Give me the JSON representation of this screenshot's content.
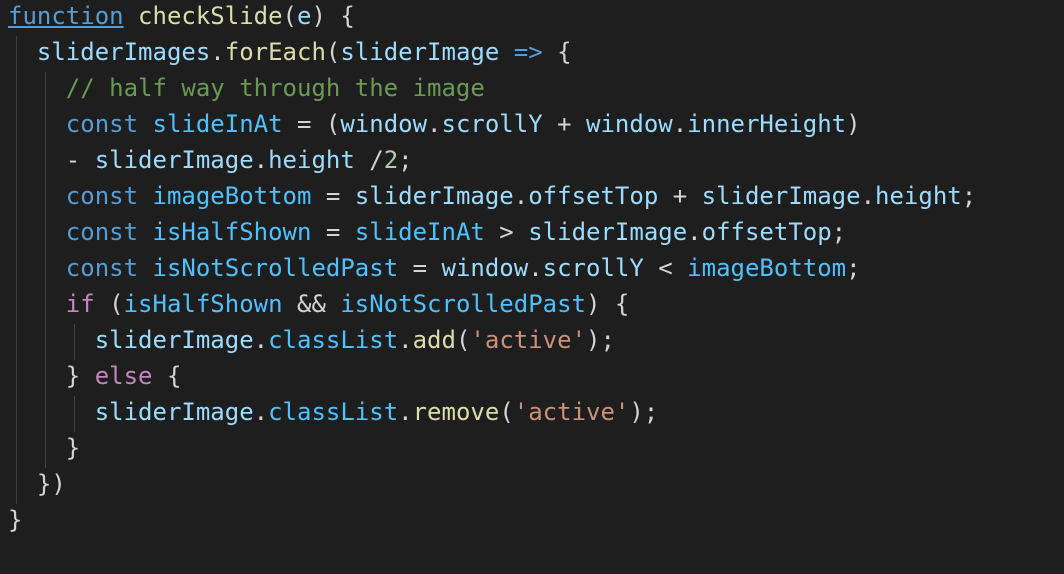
{
  "editor": {
    "background": "#1e1e1e",
    "lines": [
      [
        {
          "t": "function",
          "c": "kw",
          "u": true
        },
        {
          "t": " ",
          "c": "punc"
        },
        {
          "t": "checkSlide",
          "c": "fn"
        },
        {
          "t": "(",
          "c": "punc"
        },
        {
          "t": "e",
          "c": "var"
        },
        {
          "t": ") {",
          "c": "punc"
        }
      ],
      [
        {
          "t": "  ",
          "c": "punc"
        },
        {
          "t": "sliderImages",
          "c": "var"
        },
        {
          "t": ".",
          "c": "punc"
        },
        {
          "t": "forEach",
          "c": "fn"
        },
        {
          "t": "(",
          "c": "punc"
        },
        {
          "t": "sliderImage",
          "c": "var"
        },
        {
          "t": " ",
          "c": "punc"
        },
        {
          "t": "=>",
          "c": "kw"
        },
        {
          "t": " {",
          "c": "punc"
        }
      ],
      [
        {
          "t": "    ",
          "c": "punc"
        },
        {
          "t": "// half way through the image",
          "c": "com"
        }
      ],
      [
        {
          "t": "    ",
          "c": "punc"
        },
        {
          "t": "const",
          "c": "kw"
        },
        {
          "t": " ",
          "c": "punc"
        },
        {
          "t": "slideInAt",
          "c": "const"
        },
        {
          "t": " = (",
          "c": "op"
        },
        {
          "t": "window",
          "c": "var"
        },
        {
          "t": ".",
          "c": "punc"
        },
        {
          "t": "scrollY",
          "c": "var"
        },
        {
          "t": " + ",
          "c": "op"
        },
        {
          "t": "window",
          "c": "var"
        },
        {
          "t": ".",
          "c": "punc"
        },
        {
          "t": "innerHeight",
          "c": "var"
        },
        {
          "t": ")",
          "c": "punc"
        }
      ],
      [
        {
          "t": "    ",
          "c": "punc"
        },
        {
          "t": "- ",
          "c": "op"
        },
        {
          "t": "sliderImage",
          "c": "var"
        },
        {
          "t": ".",
          "c": "punc"
        },
        {
          "t": "height",
          "c": "var"
        },
        {
          "t": " /",
          "c": "op"
        },
        {
          "t": "2",
          "c": "num"
        },
        {
          "t": ";",
          "c": "punc"
        }
      ],
      [
        {
          "t": "    ",
          "c": "punc"
        },
        {
          "t": "const",
          "c": "kw"
        },
        {
          "t": " ",
          "c": "punc"
        },
        {
          "t": "imageBottom",
          "c": "const"
        },
        {
          "t": " = ",
          "c": "op"
        },
        {
          "t": "sliderImage",
          "c": "var"
        },
        {
          "t": ".",
          "c": "punc"
        },
        {
          "t": "offsetTop",
          "c": "var"
        },
        {
          "t": " + ",
          "c": "op"
        },
        {
          "t": "sliderImage",
          "c": "var"
        },
        {
          "t": ".",
          "c": "punc"
        },
        {
          "t": "height",
          "c": "var"
        },
        {
          "t": ";",
          "c": "punc"
        }
      ],
      [
        {
          "t": "    ",
          "c": "punc"
        },
        {
          "t": "const",
          "c": "kw"
        },
        {
          "t": " ",
          "c": "punc"
        },
        {
          "t": "isHalfShown",
          "c": "const"
        },
        {
          "t": " = ",
          "c": "op"
        },
        {
          "t": "slideInAt",
          "c": "const"
        },
        {
          "t": " > ",
          "c": "op"
        },
        {
          "t": "sliderImage",
          "c": "var"
        },
        {
          "t": ".",
          "c": "punc"
        },
        {
          "t": "offsetTop",
          "c": "var"
        },
        {
          "t": ";",
          "c": "punc"
        }
      ],
      [
        {
          "t": "    ",
          "c": "punc"
        },
        {
          "t": "const",
          "c": "kw"
        },
        {
          "t": " ",
          "c": "punc"
        },
        {
          "t": "isNotScrolledPast",
          "c": "const"
        },
        {
          "t": " = ",
          "c": "op"
        },
        {
          "t": "window",
          "c": "var"
        },
        {
          "t": ".",
          "c": "punc"
        },
        {
          "t": "scrollY",
          "c": "var"
        },
        {
          "t": " < ",
          "c": "op"
        },
        {
          "t": "imageBottom",
          "c": "const"
        },
        {
          "t": ";",
          "c": "punc"
        }
      ],
      [
        {
          "t": "    ",
          "c": "punc"
        },
        {
          "t": "if",
          "c": "ctrl"
        },
        {
          "t": " (",
          "c": "punc"
        },
        {
          "t": "isHalfShown",
          "c": "const"
        },
        {
          "t": " && ",
          "c": "op"
        },
        {
          "t": "isNotScrolledPast",
          "c": "const"
        },
        {
          "t": ") {",
          "c": "punc"
        }
      ],
      [
        {
          "t": "      ",
          "c": "punc"
        },
        {
          "t": "sliderImage",
          "c": "var"
        },
        {
          "t": ".",
          "c": "punc"
        },
        {
          "t": "classList",
          "c": "const"
        },
        {
          "t": ".",
          "c": "punc"
        },
        {
          "t": "add",
          "c": "fn"
        },
        {
          "t": "(",
          "c": "punc"
        },
        {
          "t": "'active'",
          "c": "str"
        },
        {
          "t": ");",
          "c": "punc"
        }
      ],
      [
        {
          "t": "    ",
          "c": "punc"
        },
        {
          "t": "} ",
          "c": "punc"
        },
        {
          "t": "else",
          "c": "ctrl"
        },
        {
          "t": " {",
          "c": "punc"
        }
      ],
      [
        {
          "t": "      ",
          "c": "punc"
        },
        {
          "t": "sliderImage",
          "c": "var"
        },
        {
          "t": ".",
          "c": "punc"
        },
        {
          "t": "classList",
          "c": "const"
        },
        {
          "t": ".",
          "c": "punc"
        },
        {
          "t": "remove",
          "c": "fn"
        },
        {
          "t": "(",
          "c": "punc"
        },
        {
          "t": "'active'",
          "c": "str"
        },
        {
          "t": ");",
          "c": "punc"
        }
      ],
      [
        {
          "t": "    ",
          "c": "punc"
        },
        {
          "t": "}",
          "c": "punc"
        }
      ],
      [
        {
          "t": "  ",
          "c": "punc"
        },
        {
          "t": "})",
          "c": "punc"
        }
      ],
      [
        {
          "t": "}",
          "c": "punc"
        }
      ]
    ]
  }
}
